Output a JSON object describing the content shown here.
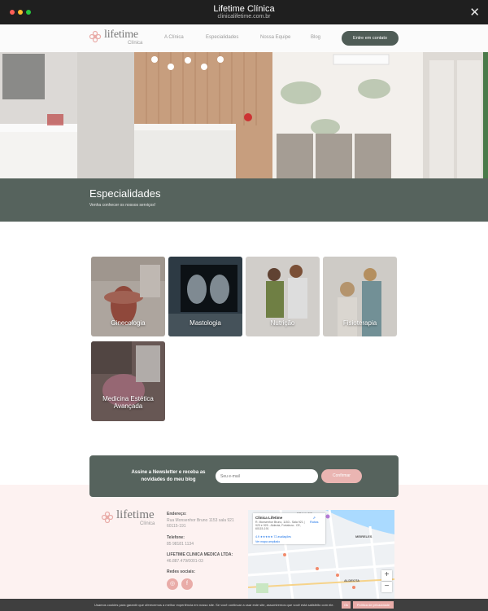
{
  "window": {
    "title": "Lifetime Clínica",
    "url": "clinicalifetime.com.br"
  },
  "brand": {
    "name": "lifetime",
    "sub": "Clínica",
    "accent": "#e9aca8",
    "dark_green": "#56635d"
  },
  "nav": {
    "links": [
      "A Clínica",
      "Especialidades",
      "Nossa Equipe",
      "Blog"
    ],
    "cta": "Entre em contato"
  },
  "hero": {
    "title": "Especialidades",
    "subtitle": "Venha conhecer os nossos serviços!"
  },
  "specialties": [
    "Ginecologia",
    "Mastologia",
    "Nutrição",
    "Fisioterapia",
    "Medicina Estética Avançada"
  ],
  "newsletter": {
    "text": "Assine a Newsletter e receba as novidades do meu blog",
    "placeholder": "Seu e-mail",
    "button": "Confirmar"
  },
  "footer": {
    "address_label": "Endereço:",
    "address": "Rua Monsenhor Bruno 1153 sala 921",
    "address_line2": "60115-191",
    "phone_label": "Telefone:",
    "phone": "85 98181 1134",
    "company_label": "LIFETIME CLINICA MEDICA LTDA:",
    "cnpj": "46.887.479/0001-03",
    "social_label": "Redes sociais:"
  },
  "map": {
    "place_name": "Clínica Lifetime",
    "place_address": "R. Monsenhor Bruno, 1153 - Sala 921 | 923 e 925 - Aldeota, Fortaleza - CE, 60115-191",
    "rating": "4.9 ★★★★★",
    "reviews": "72 avaliações",
    "larger_map": "Ver mapa ampliado",
    "directions": "Rotas",
    "labels": [
      "PRAIA DE",
      "MEIRELES",
      "ALDEOTA"
    ]
  },
  "cookie": {
    "text": "Usamos cookies para garantir que oferecemos a melhor experiência em nosso site. Se você continuar a usar este site, assumiremos que você está satisfeito com ele.",
    "ok": "Ok",
    "policy": "Política de privacidade"
  }
}
